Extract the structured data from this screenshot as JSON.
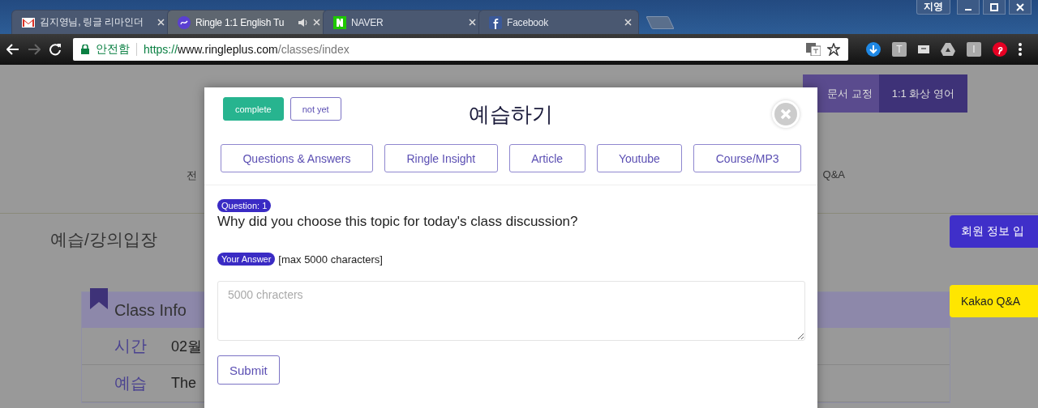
{
  "browser": {
    "tabs": [
      {
        "title": "김지영님, 링글 리마인더",
        "selected": false,
        "audio": false
      },
      {
        "title": "Ringle 1:1 English Tu",
        "selected": true,
        "audio": true
      },
      {
        "title": "NAVER",
        "selected": false,
        "audio": false
      },
      {
        "title": "Facebook",
        "selected": false,
        "audio": false
      }
    ],
    "profile": "지영",
    "security_label": "안전함",
    "url": {
      "scheme": "https://",
      "host": "www.ringleplus.com",
      "path": "/classes/index"
    },
    "forward_disabled": true,
    "extensions": [
      {
        "kind": "download"
      },
      {
        "kind": "letter",
        "letter": "T"
      },
      {
        "kind": "screen"
      },
      {
        "kind": "drive"
      },
      {
        "kind": "letter",
        "letter": "I"
      },
      {
        "kind": "pinterest"
      }
    ]
  },
  "page": {
    "header_buttons": [
      {
        "label": "문서 교정",
        "selected": false
      },
      {
        "label": "1:1 화상 영어",
        "selected": true
      }
    ],
    "nav": [
      "전",
      "Q&A"
    ],
    "section_title": "예습/강의입장",
    "class_info": {
      "title": "Class Info",
      "rows": [
        {
          "label": "시간",
          "value": "02월"
        },
        {
          "label": "예습",
          "value": "The"
        }
      ]
    },
    "side_buttons": [
      {
        "label": "회원 정보 입",
        "kind": "member"
      },
      {
        "label": "Kakao Q&A",
        "kind": "kakao"
      }
    ]
  },
  "modal": {
    "status": [
      {
        "label": "complete",
        "selected": true
      },
      {
        "label": "not yet",
        "selected": false
      }
    ],
    "title": "예습하기",
    "tabs": [
      {
        "label": "Questions & Answers",
        "selected": false
      },
      {
        "label": "Ringle Insight",
        "selected": false
      },
      {
        "label": "Article",
        "selected": false
      },
      {
        "label": "Youtube",
        "selected": false
      },
      {
        "label": "Course/MP3",
        "selected": false
      }
    ],
    "question_badge": "Question: 1",
    "question": "Why did you choose this topic for today's class discussion?",
    "answer_badge": "Your Answer",
    "answer_hint": "[max 5000 characters]",
    "answer": {
      "placeholder": "5000 chracters"
    },
    "submit": "Submit"
  }
}
